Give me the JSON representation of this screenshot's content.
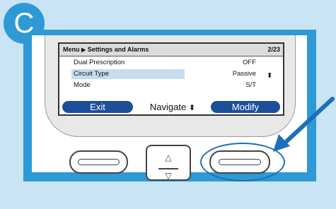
{
  "step_letter": "C",
  "screen": {
    "menu_label": "Menu",
    "breadcrumb_arrow": "▶",
    "section_title": "Settings and Alarms",
    "page_indicator": "2/23",
    "rows": [
      {
        "label": "Dual Prescription",
        "value": "OFF"
      },
      {
        "label": "Circuit Type",
        "value": "Passive",
        "selected": true
      },
      {
        "label": "Mode",
        "value": "S/T"
      }
    ],
    "updown_glyph": "⬍"
  },
  "softkeys": {
    "left": "Exit",
    "center": "Navigate",
    "center_glyph": "⬍",
    "right": "Modify"
  },
  "colors": {
    "panel": "#2d9ad6",
    "background": "#c9e4f5",
    "softkey": "#1c4e9a",
    "highlight": "#c6dcef",
    "callout": "#1c6fb8"
  },
  "icons": {
    "nav_up": "△",
    "nav_down": "▽"
  }
}
